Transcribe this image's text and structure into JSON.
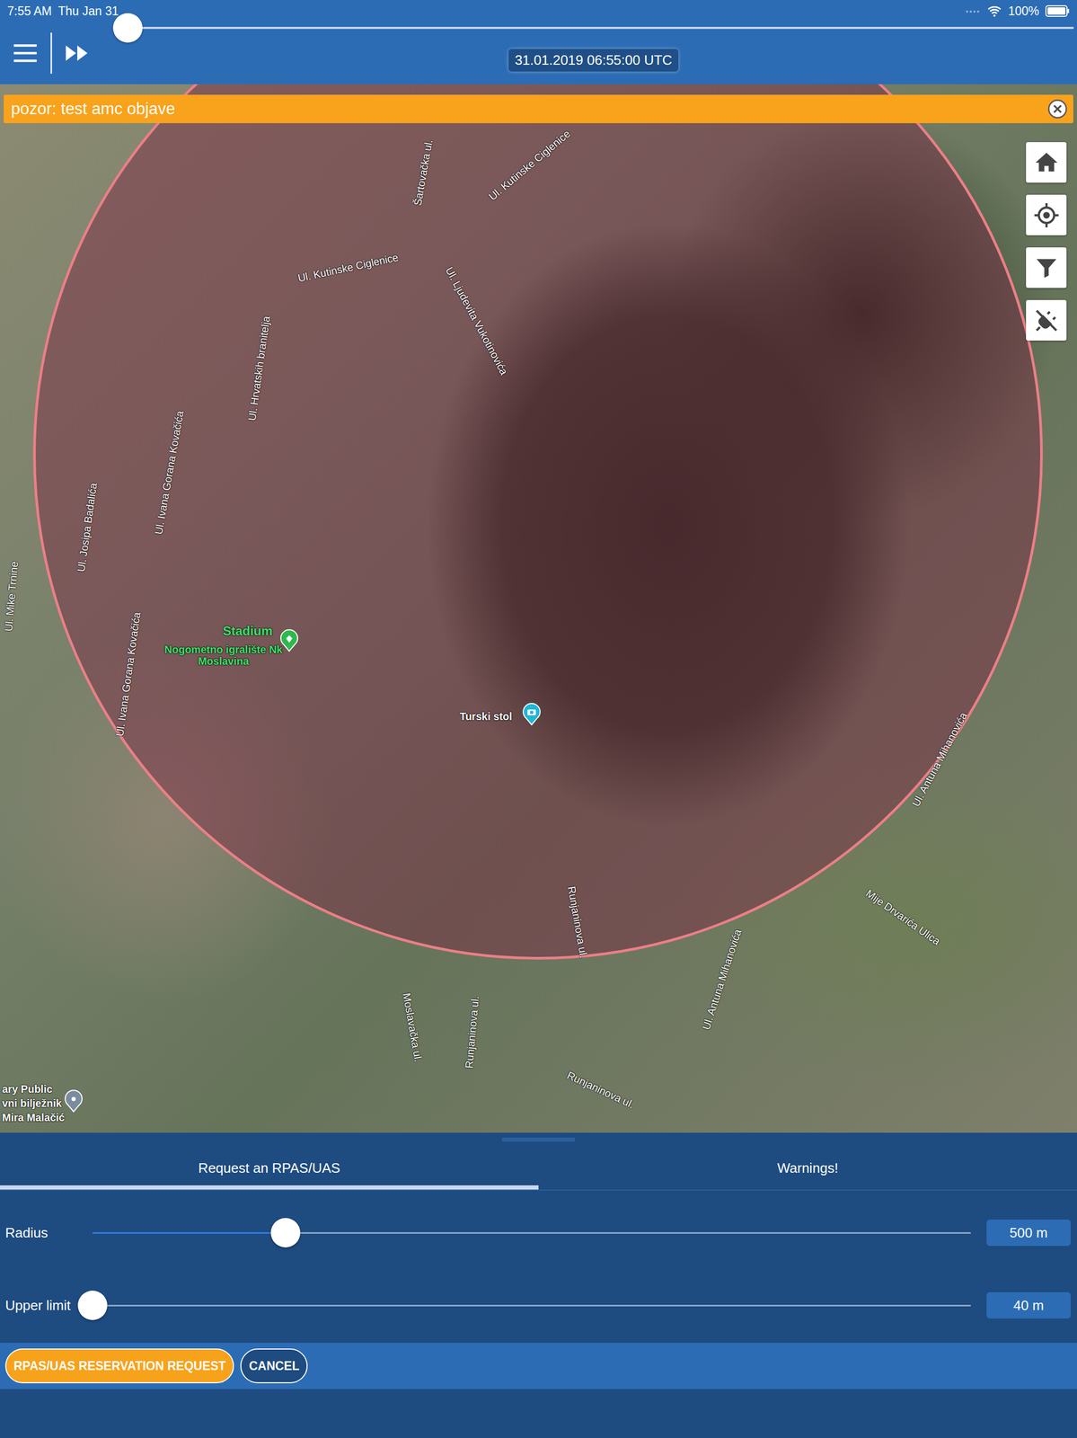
{
  "status_bar": {
    "time": "7:55 AM",
    "date": "Thu Jan 31",
    "battery": "100%",
    "battery_level": 1
  },
  "toolbar": {
    "time_slider": {
      "level": 0
    },
    "timestamp": "31.01.2019 06:55:00 UTC"
  },
  "banner": {
    "text": "pozor: test amc objave"
  },
  "map": {
    "labels": [
      {
        "text": "Ul. Kutinske Ciglenice",
        "kind": "street"
      },
      {
        "text": "Ul. Kutinske Ciglenice",
        "kind": "street"
      },
      {
        "text": "Ul. Ljudevita Vukotinovića",
        "kind": "street"
      },
      {
        "text": "Ul. Hrvatskih branitelja",
        "kind": "street"
      },
      {
        "text": "Ul. Ivana Gorana Kovačića",
        "kind": "street"
      },
      {
        "text": "Ul. Josipa Badalića",
        "kind": "street"
      },
      {
        "text": "Ul. Ivana Gorana Kovačića",
        "kind": "street"
      },
      {
        "text": "Šartovačka ul.",
        "kind": "street"
      },
      {
        "text": "Ul. Mike Trnine",
        "kind": "street"
      },
      {
        "text": "Stadium",
        "kind": "place"
      },
      {
        "text": "Nogometno igralište Nk Moslavina",
        "kind": "place"
      },
      {
        "text": "Turski stol",
        "kind": "poi"
      },
      {
        "text": "Ul. Antuna Mihanovića",
        "kind": "street"
      },
      {
        "text": "Ul. Antuna Mihanovića",
        "kind": "street"
      },
      {
        "text": "Mije Drvarića Ulica",
        "kind": "street"
      },
      {
        "text": "Runjaninova ul.",
        "kind": "street"
      },
      {
        "text": "Moslavačka ul.",
        "kind": "street"
      },
      {
        "text": "Runjaninova ul.",
        "kind": "street"
      },
      {
        "text": "Runjaninova ul.",
        "kind": "street"
      },
      {
        "text": "ary Public",
        "kind": "poi"
      },
      {
        "text": "vni bilježnik",
        "kind": "poi"
      },
      {
        "text": "Mira Malačić",
        "kind": "poi"
      }
    ]
  },
  "tabs": [
    {
      "label": "Request an RPAS/UAS",
      "selected": true
    },
    {
      "label": "Warnings!",
      "selected": false
    }
  ],
  "sliders": [
    {
      "label": "Radius",
      "level": 0.22,
      "value": "500 m"
    },
    {
      "label": "Upper limit",
      "level": 0,
      "value": "40 m"
    }
  ],
  "buttons": [
    {
      "label": "RPAS/UAS RESERVATION REQUEST",
      "kind": "primary"
    },
    {
      "label": "CANCEL",
      "kind": "secondary"
    }
  ]
}
